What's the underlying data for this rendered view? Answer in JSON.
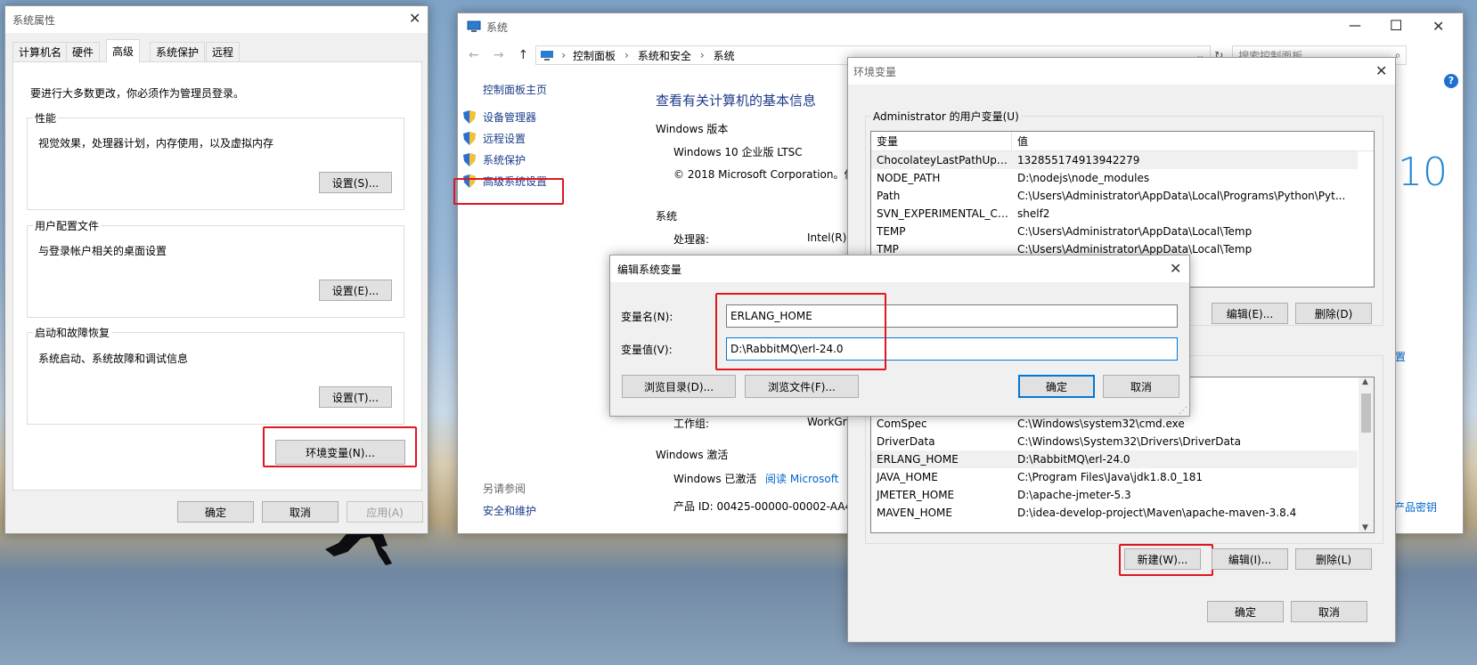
{
  "sysprops": {
    "title": "系统属性",
    "tabs": [
      "计算机名",
      "硬件",
      "高级",
      "系统保护",
      "远程"
    ],
    "notice": "要进行大多数更改，你必须作为管理员登录。",
    "perf_label": "性能",
    "perf_desc": "视觉效果，处理器计划，内存使用，以及虚拟内存",
    "perf_btn": "设置(S)...",
    "profile_label": "用户配置文件",
    "profile_desc": "与登录帐户相关的桌面设置",
    "profile_btn": "设置(E)...",
    "startup_label": "启动和故障恢复",
    "startup_desc": "系统启动、系统故障和调试信息",
    "startup_btn": "设置(T)...",
    "env_btn": "环境变量(N)...",
    "ok": "确定",
    "cancel": "取消",
    "apply": "应用(A)"
  },
  "system": {
    "title": "系统",
    "breadcrumb": [
      "控制面板",
      "系统和安全",
      "系统"
    ],
    "search_placeholder": "搜索控制面板",
    "side_home": "控制面板主页",
    "side_links": [
      "设备管理器",
      "远程设置",
      "系统保护",
      "高级系统设置"
    ],
    "see_also": "另请参阅",
    "security": "安全和维护",
    "heading": "查看有关计算机的基本信息",
    "win_edition_label": "Windows 版本",
    "edition": "Windows 10 企业版 LTSC",
    "copyright": "© 2018 Microsoft Corporation。保",
    "system_label": "系统",
    "processor_label": "处理器:",
    "processor_value": "Intel(R)",
    "workgroup_label": "工作组:",
    "workgroup_value": "WorkGr",
    "activation_label": "Windows 激活",
    "activated": "Windows 已激活",
    "ms_link": "阅读 Microsoft",
    "product_id": "产品 ID: 00425-00000-00002-AA4",
    "logo_text": "10",
    "side_link_fragment": "置",
    "product_key": "产品密钥"
  },
  "envvars": {
    "title": "环境变量",
    "user_group": "Administrator 的用户变量(U)",
    "col_var": "变量",
    "col_val": "值",
    "user_vars": [
      {
        "name": "ChocolateyLastPathUpdate",
        "value": "132855174913942279"
      },
      {
        "name": "NODE_PATH",
        "value": "D:\\nodejs\\node_modules"
      },
      {
        "name": "Path",
        "value": "C:\\Users\\Administrator\\AppData\\Local\\Programs\\Python\\Pyt..."
      },
      {
        "name": "SVN_EXPERIMENTAL_CO...",
        "value": "shelf2"
      },
      {
        "name": "TEMP",
        "value": "C:\\Users\\Administrator\\AppData\\Local\\Temp"
      },
      {
        "name": "TMP",
        "value": "C:\\Users\\Administrator\\AppData\\Local\\Temp"
      }
    ],
    "user_edit": "编辑(E)...",
    "user_delete": "删除(D)",
    "sys_vars": [
      {
        "name": "ComSpec",
        "value": "C:\\Windows\\system32\\cmd.exe"
      },
      {
        "name": "DriverData",
        "value": "C:\\Windows\\System32\\Drivers\\DriverData"
      },
      {
        "name": "ERLANG_HOME",
        "value": "D:\\RabbitMQ\\erl-24.0"
      },
      {
        "name": "JAVA_HOME",
        "value": "C:\\Program Files\\Java\\jdk1.8.0_181"
      },
      {
        "name": "JMETER_HOME",
        "value": "D:\\apache-jmeter-5.3"
      },
      {
        "name": "MAVEN_HOME",
        "value": "D:\\idea-develop-project\\Maven\\apache-maven-3.8.4"
      }
    ],
    "sys_new": "新建(W)...",
    "sys_edit": "编辑(I)...",
    "sys_delete": "删除(L)",
    "ok": "确定",
    "cancel": "取消"
  },
  "editdlg": {
    "title": "编辑系统变量",
    "name_label": "变量名(N):",
    "name_value": "ERLANG_HOME",
    "value_label": "变量值(V):",
    "value_value": "D:\\RabbitMQ\\erl-24.0",
    "browse_dir": "浏览目录(D)...",
    "browse_file": "浏览文件(F)...",
    "ok": "确定",
    "cancel": "取消"
  }
}
